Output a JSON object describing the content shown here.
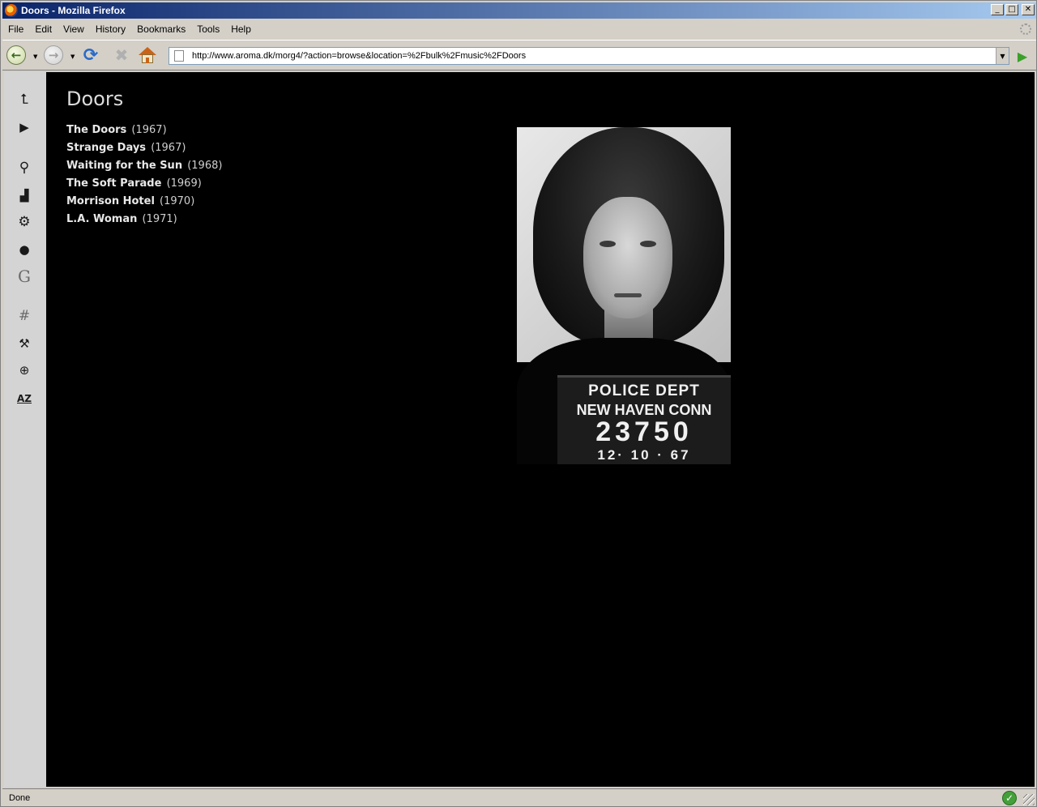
{
  "window": {
    "title": "Doors - Mozilla Firefox",
    "controls": {
      "minimize": "_",
      "maximize": "□",
      "close": "✕"
    }
  },
  "menu": {
    "items": [
      "File",
      "Edit",
      "View",
      "History",
      "Bookmarks",
      "Tools",
      "Help"
    ]
  },
  "toolbar": {
    "url": "http://www.aroma.dk/morg4/?action=browse&location=%2Fbulk%2Fmusic%2FDoors",
    "icons": [
      "back-icon",
      "forward-icon",
      "reload-icon",
      "stop-icon",
      "home-icon",
      "go-icon"
    ]
  },
  "sidebar": {
    "icons": [
      {
        "name": "up-icon",
        "glyph": "⮤"
      },
      {
        "name": "play-icon",
        "glyph": "▶"
      },
      {
        "name": "search-icon",
        "glyph": "⚲"
      },
      {
        "name": "stats-icon",
        "glyph": "▟"
      },
      {
        "name": "settings-icon",
        "glyph": "⚙"
      },
      {
        "name": "theme-icon",
        "glyph": "●"
      },
      {
        "name": "google-icon",
        "glyph": "G"
      },
      {
        "name": "hash-icon",
        "glyph": "#"
      },
      {
        "name": "tools-icon",
        "glyph": "⚒"
      },
      {
        "name": "compass-icon",
        "glyph": "⊕"
      },
      {
        "name": "sort-az-icon",
        "glyph": "AZ"
      }
    ]
  },
  "main": {
    "title": "Doors",
    "albums": [
      {
        "title": "The Doors",
        "year": "(1967)"
      },
      {
        "title": "Strange Days",
        "year": "(1967)"
      },
      {
        "title": "Waiting for the Sun",
        "year": "(1968)"
      },
      {
        "title": "The Soft Parade",
        "year": "(1969)"
      },
      {
        "title": "Morrison Hotel",
        "year": "(1970)"
      },
      {
        "title": "L.A. Woman",
        "year": "(1971)"
      }
    ],
    "photo_placard": {
      "line1": "POLICE DEPT",
      "line2": "NEW HAVEN CONN",
      "line3": "23750",
      "line4": "12· 10 · 67"
    }
  },
  "status": {
    "text": "Done"
  }
}
